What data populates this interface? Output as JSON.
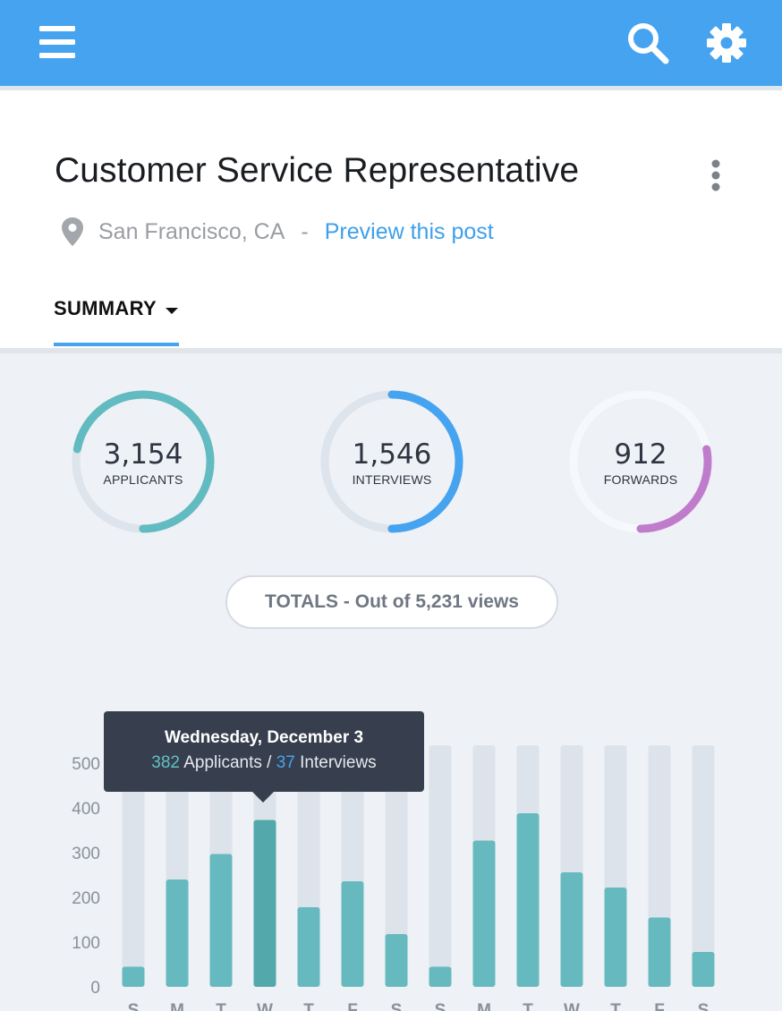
{
  "header": {
    "job_title": "Customer Service Representative",
    "location": "San Francisco, CA",
    "separator": "-",
    "preview_link": "Preview this post",
    "tab_label": "SUMMARY"
  },
  "icons": {
    "menu": "hamburger-menu-icon",
    "search": "search-icon",
    "settings": "gear-icon",
    "more": "vertical-dots-icon",
    "location": "map-pin-icon",
    "dropdown": "caret-down-icon"
  },
  "colors": {
    "topbar": "#45a3ef",
    "applicants": "#62bbc0",
    "interviews": "#45a3ef",
    "forwards": "#c07ccc",
    "track": "#dde4ec",
    "link": "#3ea0ea"
  },
  "stats": [
    {
      "value": "3,154",
      "label": "APPLICANTS",
      "fraction": 0.72
    },
    {
      "value": "1,546",
      "label": "INTERVIEWS",
      "fraction": 0.5
    },
    {
      "value": "912",
      "label": "FORWARDS",
      "fraction": 0.28
    }
  ],
  "totals_label": "TOTALS - Out of 5,231 views",
  "tooltip": {
    "date": "Wednesday, December 3",
    "applicants_count": "382",
    "applicants_text": " Applicants / ",
    "interviews_count": "37",
    "interviews_text": " Interviews"
  },
  "chart_data": {
    "type": "bar",
    "categories": [
      "S",
      "M",
      "T",
      "W",
      "T",
      "F",
      "S",
      "S",
      "M",
      "T",
      "W",
      "T",
      "F",
      "S"
    ],
    "values": [
      45,
      240,
      297,
      373,
      178,
      236,
      118,
      45,
      327,
      388,
      256,
      222,
      155,
      78
    ],
    "ylim": [
      0,
      540
    ],
    "yticks": [
      0,
      100,
      200,
      300,
      400,
      500
    ],
    "highlight_index": 3
  }
}
